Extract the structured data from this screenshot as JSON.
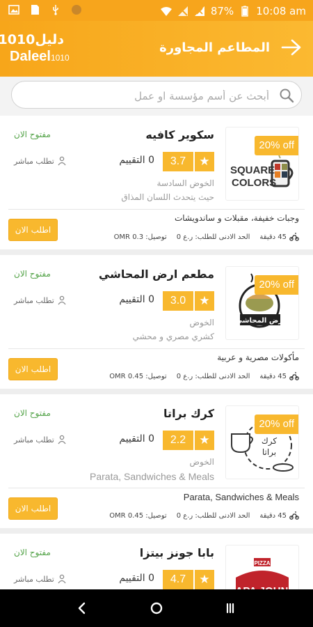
{
  "status_bar": {
    "battery": "87%",
    "time": "10:08 am"
  },
  "header": {
    "logo_ar": "دليل1010",
    "logo_en": "Daleel",
    "logo_num": "1010",
    "title": "المطاعم المجاورة"
  },
  "search": {
    "placeholder": "أبحث عن أسم مؤسسة او عمل"
  },
  "restaurants": [
    {
      "name": "سكوير كافيه",
      "discount": "20% off",
      "status": "مفتوح الان",
      "rating": "3.7",
      "ratings_count": "0 التقييم",
      "direct": "تطلب مباشر",
      "location": "الخوض السادسة",
      "subtitle": "حيث يتحدث اللسان المذاق",
      "cuisine": "وجبات خفيفة، مقبلات و ساندويشات",
      "order_button": "اطلب الان",
      "delivery_time": "45 دقيقة",
      "min_order": "الحد الادنى للطلب: ر.ع 0",
      "delivery_fee": "توصيل: OMR 0.3",
      "logo_text": [
        "SQUARE",
        "COLORS"
      ]
    },
    {
      "name": "مطعم ارض المحاشي",
      "discount": "20% off",
      "status": "مفتوح الان",
      "rating": "3.0",
      "ratings_count": "0 التقييم",
      "direct": "تطلب مباشر",
      "location": "الخوض",
      "subtitle": "كشري مصري و محشي",
      "cuisine": "مأكولات مصرية و عربية",
      "order_button": "اطلب الان",
      "delivery_time": "45 دقيقة",
      "min_order": "الحد الادنى للطلب: ر.ع 0",
      "delivery_fee": "توصيل: OMR 0.45",
      "logo_text": [
        "أرض المحاشي"
      ]
    },
    {
      "name": "كرك براتا",
      "discount": "20% off",
      "status": "مفتوح الان",
      "rating": "2.2",
      "ratings_count": "0 التقييم",
      "direct": "تطلب مباشر",
      "location": "الخوض",
      "subtitle": "Parata, Sandwiches & Meals",
      "cuisine": "Parata, Sandwiches & Meals",
      "order_button": "اطلب الان",
      "delivery_time": "45 دقيقة",
      "min_order": "الحد الادنى للطلب: ر.ع 0",
      "delivery_fee": "توصيل: OMR 0.45",
      "logo_text": [
        "كرك",
        "براتا"
      ]
    },
    {
      "name": "بابا جونز بيتزا",
      "status": "مفتوح الان",
      "rating": "4.7",
      "ratings_count": "0 التقييم",
      "direct": "تطلب مباشر",
      "logo_text": [
        "PIZZA",
        "PAPA JOHNS"
      ]
    }
  ],
  "colors": {
    "accent": "#f8b82e",
    "header": "#f7a61a",
    "open": "#55a44a"
  }
}
